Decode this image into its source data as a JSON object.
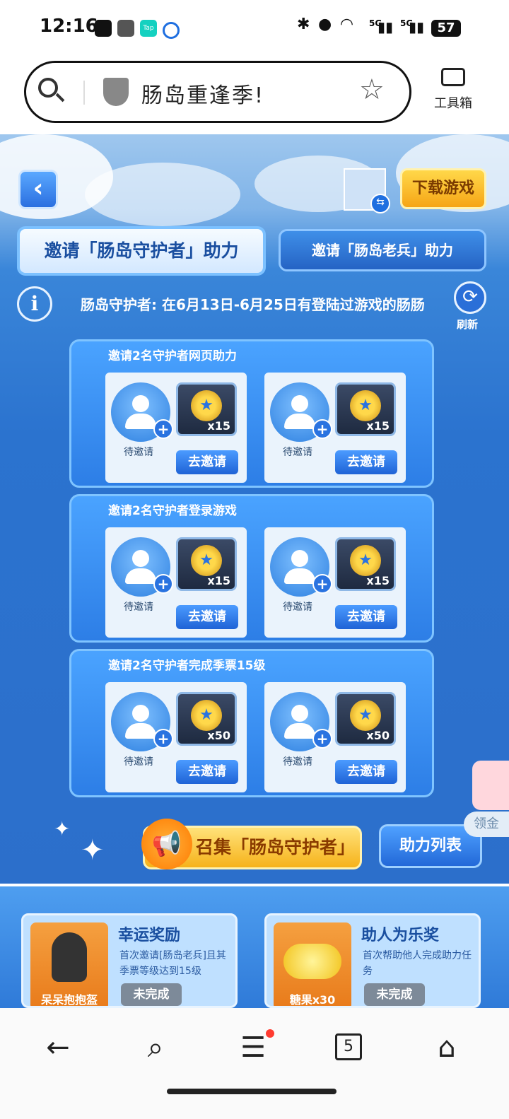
{
  "status_bar": {
    "time": "12:16",
    "battery": "57",
    "signal_labels": [
      "5G",
      "5G"
    ]
  },
  "browser": {
    "search_text": "肠岛重逢季!",
    "toolbox_label": "工具箱"
  },
  "game": {
    "download_label": "下载游戏",
    "tabs": [
      {
        "label": "邀请「肠岛守护者」助力",
        "active": true
      },
      {
        "label": "邀请「肠岛老兵」助力",
        "active": false
      }
    ],
    "info_text": "肠岛守护者: 在6月13日-6月25日有登陆过游戏的肠肠",
    "refresh_label": "刷新",
    "tasks": [
      {
        "title": "邀请2名守护者网页助力",
        "slots": [
          {
            "status": "待邀请",
            "qty": "x15",
            "button": "去邀请"
          },
          {
            "status": "待邀请",
            "qty": "x15",
            "button": "去邀请"
          }
        ]
      },
      {
        "title": "邀请2名守护者登录游戏",
        "slots": [
          {
            "status": "待邀请",
            "qty": "x15",
            "button": "去邀请"
          },
          {
            "status": "待邀请",
            "qty": "x15",
            "button": "去邀请"
          }
        ]
      },
      {
        "title": "邀请2名守护者完成季票15级",
        "slots": [
          {
            "status": "待邀请",
            "qty": "x50",
            "button": "去邀请"
          },
          {
            "status": "待邀请",
            "qty": "x50",
            "button": "去邀请"
          }
        ]
      }
    ],
    "rally_label": "召集「肠岛守护者」",
    "helper_list_label": "助力列表",
    "side_label": "领金",
    "bottom_cards": [
      {
        "title": "幸运奖励",
        "desc": "首次邀请[肠岛老兵]且其季票等级达到15级",
        "image_label": "呆呆抱抱盔",
        "status": "未完成"
      },
      {
        "title": "助人为乐奖",
        "desc": "首次帮助他人完成助力任务",
        "image_label": "糖果x30",
        "status": "未完成"
      }
    ]
  },
  "navbar": {
    "tabs_count": "5"
  },
  "colors": {
    "primary_blue": "#2c6fcb",
    "gold": "#f6b21a"
  }
}
